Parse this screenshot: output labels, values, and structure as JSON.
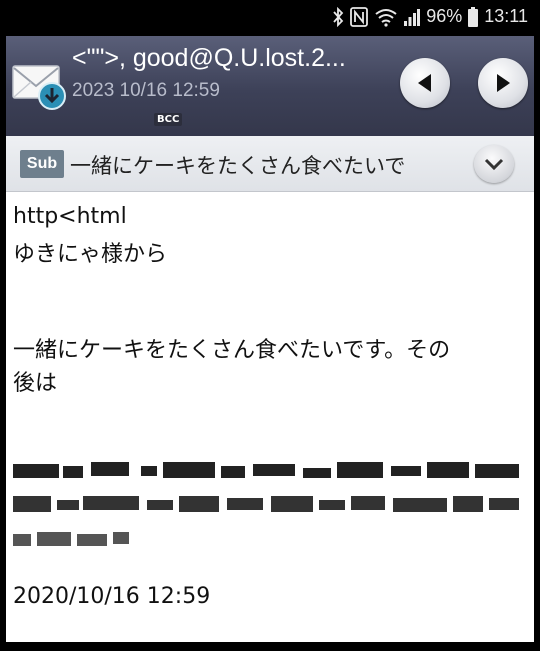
{
  "status_bar": {
    "icons": [
      "bluetooth-icon",
      "nfc-icon",
      "wifi-icon",
      "signal-icon"
    ],
    "battery": "96%",
    "time": "13:11"
  },
  "header": {
    "title": "<\"\">, good@Q.U.lost.2...",
    "date": "2023 10/16 12:59",
    "bcc_label": "BCC"
  },
  "subject": {
    "badge": "Sub",
    "text": "一緒にケーキをたくさん食べたいで"
  },
  "message": {
    "line1": "http<html",
    "line2": "ゆきにゃ様から",
    "line3": "一緒にケーキをたくさん食べたいです。その",
    "line4": "後は",
    "footer_date": "2020/10/16 12:59"
  },
  "colors": {
    "header_bg": "#3d4158",
    "subject_bg": "#e6e8ec",
    "badge_bg": "#6e7f8d"
  }
}
